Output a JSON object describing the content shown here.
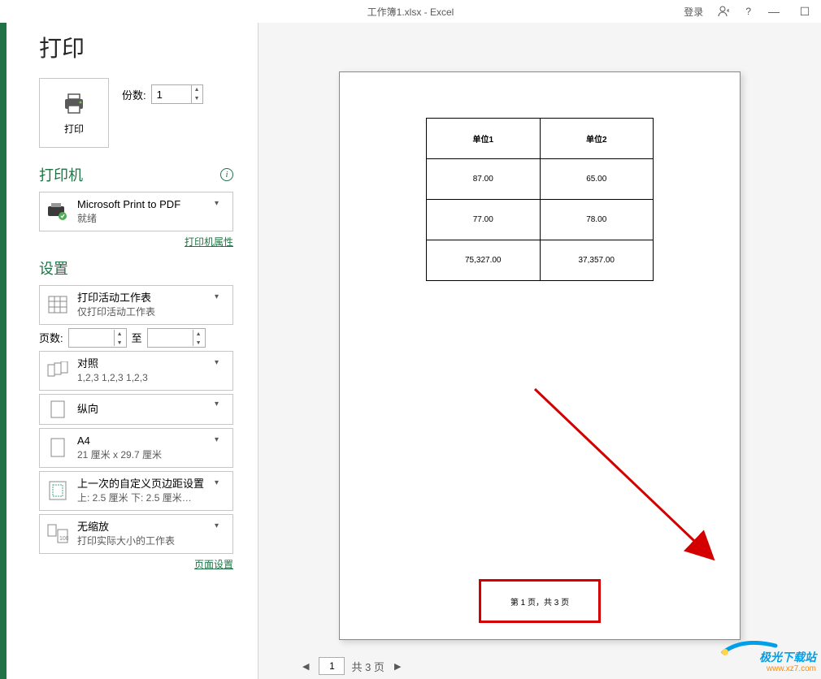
{
  "titlebar": {
    "title": "工作簿1.xlsx  -  Excel",
    "login": "登录",
    "help": "?"
  },
  "heading": "打印",
  "print_button_label": "打印",
  "copies": {
    "label": "份数:",
    "value": "1"
  },
  "printer_section": "打印机",
  "printer": {
    "name": "Microsoft Print to PDF",
    "status": "就绪"
  },
  "printer_props_link": "打印机属性",
  "settings_section": "设置",
  "setting_sheets": {
    "line1": "打印活动工作表",
    "line2": "仅打印活动工作表"
  },
  "pages": {
    "label": "页数:",
    "to": "至"
  },
  "setting_collate": {
    "line1": "对照",
    "line2": "1,2,3    1,2,3    1,2,3"
  },
  "setting_orient": {
    "line1": "纵向"
  },
  "setting_paper": {
    "line1": "A4",
    "line2": "21 厘米 x 29.7 厘米"
  },
  "setting_margins": {
    "line1": "上一次的自定义页边距设置",
    "line2": "上: 2.5 厘米 下: 2.5 厘米…"
  },
  "setting_scale": {
    "line1": "无缩放",
    "line2": "打印实际大小的工作表"
  },
  "page_setup_link": "页面设置",
  "preview": {
    "headers": [
      "单位1",
      "单位2"
    ],
    "rows": [
      [
        "87.00",
        "65.00"
      ],
      [
        "77.00",
        "78.00"
      ],
      [
        "75,327.00",
        "37,357.00"
      ]
    ],
    "footer": "第 1 页，共 3 页"
  },
  "pager": {
    "current": "1",
    "total_label": "共 3 页"
  },
  "watermark": {
    "top": "极光下载站",
    "bottom": "www.xz7.com"
  }
}
